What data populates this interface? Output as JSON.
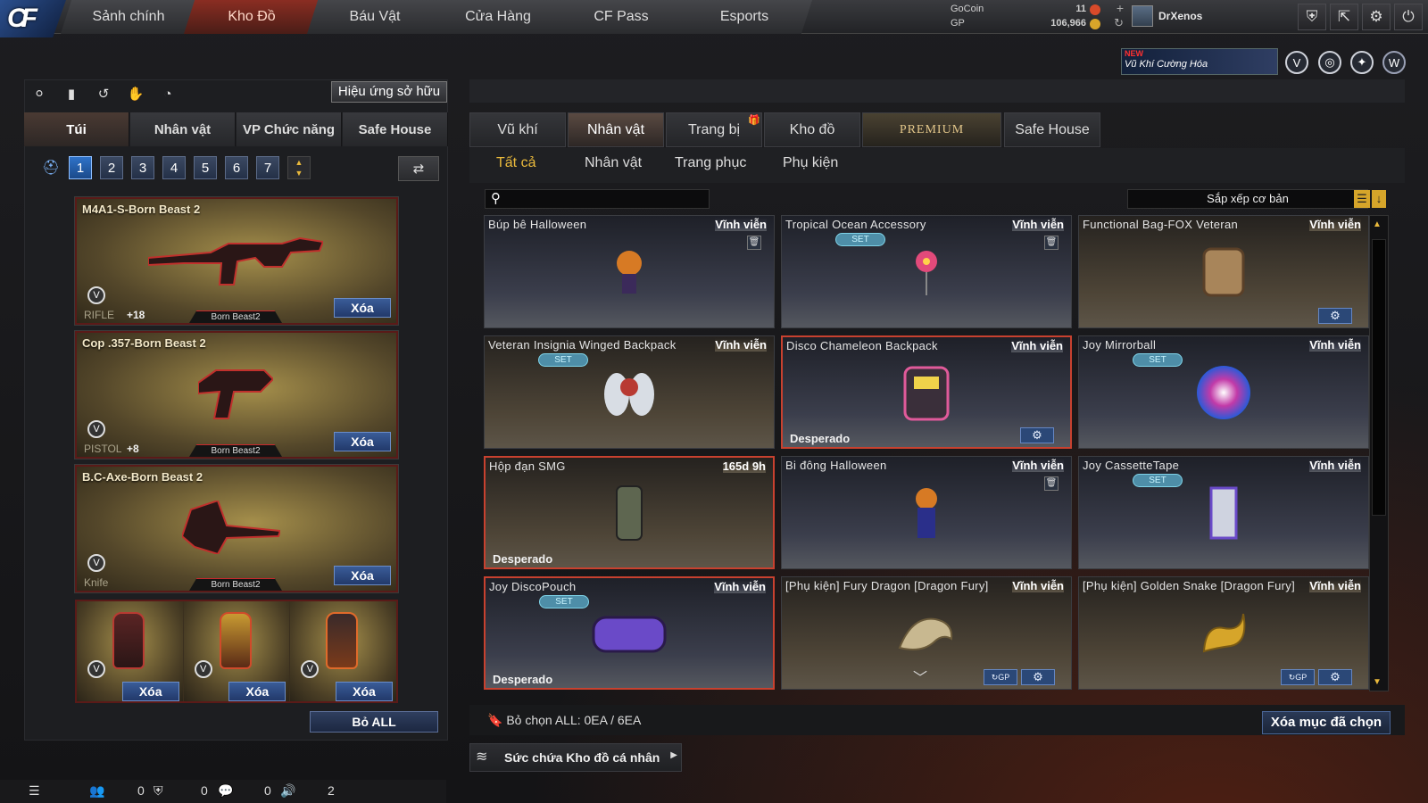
{
  "nav": {
    "logo": "CF",
    "tabs": [
      "Sảnh chính",
      "Kho Đồ",
      "Báu Vật",
      "Cửa Hàng",
      "CF Pass",
      "Esports"
    ],
    "active_tab": "Kho Đồ"
  },
  "currency": {
    "gocoin_label": "GoCoin",
    "gocoin_value": "11",
    "gp_label": "GP",
    "gp_value": "106,966"
  },
  "user": {
    "name": "DrXenos"
  },
  "promo": {
    "new": "NEW",
    "text": "Vũ Khí Cường Hóa"
  },
  "left": {
    "effect_button": "Hiệu ứng sở hữu",
    "tabs": [
      "Túi",
      "Nhân vật",
      "VP Chức năng",
      "Safe House"
    ],
    "pages": [
      "1",
      "2",
      "3",
      "4",
      "5",
      "6",
      "7"
    ],
    "slots": [
      {
        "name": "M4A1-S-Born Beast 2",
        "type": "RIFLE",
        "plus": "+18",
        "tag": "Born Beast2",
        "delete": "Xóa"
      },
      {
        "name": "Cop .357-Born Beast 2",
        "type": "PISTOL",
        "plus": "+8",
        "tag": "Born Beast2",
        "delete": "Xóa"
      },
      {
        "name": "B.C-Axe-Born Beast 2",
        "type": "Knife",
        "plus": "",
        "tag": "Born Beast2",
        "delete": "Xóa"
      }
    ],
    "grenades": [
      {
        "delete": "Xóa"
      },
      {
        "delete": "Xóa"
      },
      {
        "delete": "Xóa"
      }
    ],
    "clear_all": "Bỏ ALL"
  },
  "right": {
    "tabs": [
      "Vũ khí",
      "Nhân vật",
      "Trang bị",
      "Kho đồ",
      "PREMIUM",
      "Safe House"
    ],
    "filters": [
      "Tất cả",
      "Nhân vật",
      "Trang phục",
      "Phụ kiện"
    ],
    "sort_label": "Sắp xếp cơ bản",
    "items": [
      {
        "name": "Búp bê Halloween",
        "duration": "Vĩnh viễn",
        "set": "",
        "owner": ""
      },
      {
        "name": "Tropical Ocean Accessory",
        "duration": "Vĩnh viễn",
        "set": "SET",
        "owner": ""
      },
      {
        "name": "Functional Bag-FOX Veteran",
        "duration": "Vĩnh viễn",
        "set": "",
        "owner": ""
      },
      {
        "name": "Veteran Insignia Winged Backpack",
        "duration": "Vĩnh viễn",
        "set": "SET",
        "owner": ""
      },
      {
        "name": "Disco Chameleon Backpack",
        "duration": "Vĩnh viễn",
        "set": "",
        "owner": "Desperado"
      },
      {
        "name": "Joy Mirrorball",
        "duration": "Vĩnh viễn",
        "set": "SET",
        "owner": ""
      },
      {
        "name": "Hộp đạn SMG",
        "duration": "165d 9h",
        "set": "",
        "owner": "Desperado"
      },
      {
        "name": "Bi đông Halloween",
        "duration": "Vĩnh viễn",
        "set": "",
        "owner": ""
      },
      {
        "name": "Joy CassetteTape",
        "duration": "Vĩnh viễn",
        "set": "SET",
        "owner": ""
      },
      {
        "name": "Joy DiscoPouch",
        "duration": "Vĩnh viễn",
        "set": "SET",
        "owner": "Desperado"
      },
      {
        "name": "[Phụ kiện] Fury Dragon [Dragon Fury]",
        "duration": "Vĩnh viễn",
        "set": "",
        "owner": ""
      },
      {
        "name": "[Phụ kiện] Golden Snake [Dragon Fury]",
        "duration": "Vĩnh viễn",
        "set": "",
        "owner": ""
      }
    ],
    "select_info": "Bỏ chọn ALL: 0EA / 6EA",
    "delete_selected": "Xóa mục đã chọn",
    "capacity": "Sức chứa Kho đồ cá nhân"
  },
  "status": {
    "v1": "0",
    "v2": "0",
    "v3": "0",
    "v4": "2"
  },
  "colors": {
    "accent_red": "#8a2d22",
    "gold": "#e9b93c",
    "blue_button": "#2b4877"
  }
}
